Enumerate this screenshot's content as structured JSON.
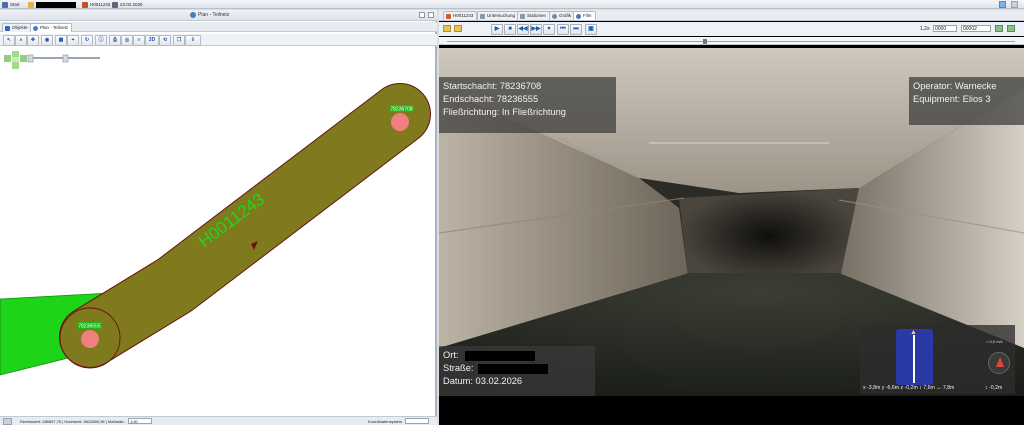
{
  "topbar": {
    "start_label": "Start",
    "case_label": "H0011243",
    "date_label": "23.02.2026"
  },
  "left": {
    "title": "Plan - Teilnetz",
    "tabs": [
      {
        "label": "Objekte"
      },
      {
        "label": "Plan - Teilnetz"
      }
    ],
    "toolbar_3d_label": "3D",
    "map": {
      "pipe_label": "H0011243",
      "node_top_label": "78236708",
      "node_bottom_label": "78236555"
    },
    "status": {
      "coords_text": "Rechtswert: 286897,75 | Hochwert: 5622890,96 | Maßstab:",
      "scale_value": "1:50",
      "right_text": "Koordinatensystem"
    }
  },
  "right": {
    "tabs": [
      {
        "label": "H0011243"
      },
      {
        "label": "Untersuchung"
      },
      {
        "label": "Stationen"
      },
      {
        "label": "Grafik"
      },
      {
        "label": "Film"
      }
    ],
    "playback": {
      "position_prefix": "1,2s",
      "time_a": "0000",
      "time_b": "00002"
    },
    "video": {
      "overlay_top_left": [
        "Startschacht: 78236708",
        "Endschacht: 78236555",
        "Fließrichtung: In Fließrichtung"
      ],
      "overlay_top_right": [
        "Operator: Warnecke",
        "Equipment: Elios 3"
      ],
      "overlay_bottom_left": {
        "ort_label": "Ort:",
        "strasse_label": "Straße:",
        "datum_label": "Datum: 03.02.2026"
      },
      "minimap": {
        "scale_text": "x -3,8m  y -6,6m  z -0,2m  ↕ 7,6m  ↔ 7,8m",
        "height_text": "↕ -0,2m",
        "top_text": "⌂ 0,0 m/s"
      }
    }
  },
  "colors": {
    "pipe_fill": "#7f7a1e",
    "pipe_outline": "#6b1212",
    "pipe_green": "#1ed418",
    "label_green": "#22d61a",
    "node_red": "#f08080",
    "overlay_bg": "#3a3a3a"
  }
}
